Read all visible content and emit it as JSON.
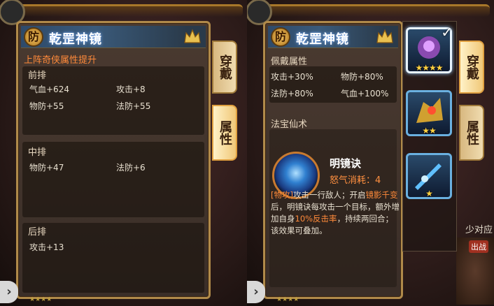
{
  "left": {
    "badge": "防",
    "title": "乾罡神镜",
    "subtitle": "上阵奇侠属性提升",
    "sections": [
      {
        "label": "前排",
        "stats": [
          "气血+624",
          "攻击+8",
          "物防+55",
          "法防+55"
        ]
      },
      {
        "label": "中排",
        "stats": [
          "物防+47",
          "法防+6"
        ]
      },
      {
        "label": "后排",
        "stats": [
          "攻击+13"
        ]
      }
    ],
    "tabs": [
      "穿戴",
      "属性"
    ]
  },
  "right": {
    "badge": "防",
    "title": "乾罡神镜",
    "wear_label": "佩戴属性",
    "wear_stats": [
      "攻击+30%",
      "物防+80%",
      "法防+80%",
      "气血+100%"
    ],
    "skill_section_label": "法宝仙术",
    "skill_name": "明镜诀",
    "skill_cost": "怒气消耗：4",
    "skill_desc_parts": [
      "[物攻]",
      "攻击一行敌人；开启",
      "镜影千变",
      "后，明镜诀每攻击一个目标，额外增加自身",
      "10%反击率",
      "，持续两回合；该效果可叠加。"
    ],
    "equip_stars": [
      "★★★★",
      "★★",
      "★"
    ],
    "tabs": [
      "穿戴",
      "属性"
    ]
  },
  "background": {
    "fragment_text": "少对应",
    "chuzhan_label": "出战"
  },
  "colors": {
    "accent_orange": "#ff8a3a",
    "frame_gold": "#b08a4a"
  }
}
